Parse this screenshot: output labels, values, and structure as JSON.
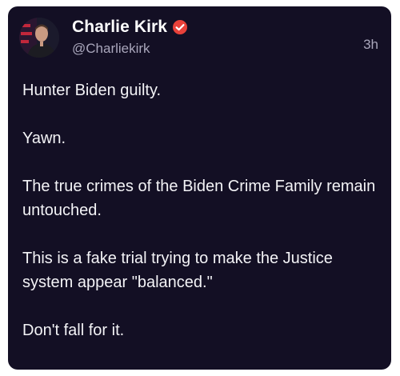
{
  "post": {
    "author": {
      "display_name": "Charlie Kirk",
      "handle": "@Charliekirk",
      "verified": true,
      "verified_color": "#e8413a",
      "avatar_icon": "profile-photo"
    },
    "timestamp": "3h",
    "paragraphs": [
      "Hunter Biden guilty.",
      "Yawn.",
      "The true crimes of the Biden Crime Family remain untouched.",
      "This is a fake trial trying to make the Justice system appear \"balanced.\"",
      "Don't fall for it."
    ]
  },
  "colors": {
    "card_background": "#130f24",
    "text_primary": "#f3f3f6",
    "text_secondary": "#a9a6bb"
  }
}
